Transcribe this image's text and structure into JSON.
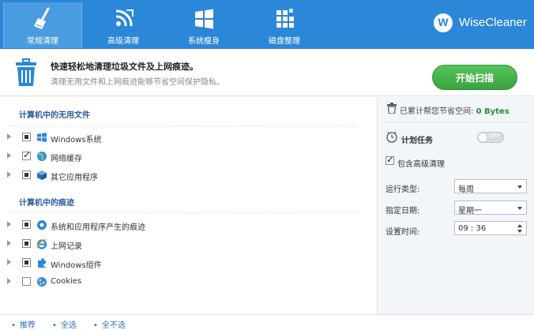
{
  "nav": {
    "tabs": [
      {
        "label": "常规清理",
        "icon": "broom-icon",
        "active": true
      },
      {
        "label": "高级清理",
        "icon": "rss-icon",
        "active": false
      },
      {
        "label": "系统瘦身",
        "icon": "windows-logo-icon",
        "active": false
      },
      {
        "label": "磁盘整理",
        "icon": "disk-defrag-icon",
        "active": false
      }
    ],
    "brand": {
      "logo_letter": "W",
      "name": "WiseCleaner"
    }
  },
  "header": {
    "title": "快速轻松地清理垃圾文件及上网痕迹。",
    "subtitle": "清理无用文件和上网痕迹能够节省空间保护隐私。",
    "scan_button": "开始扫描"
  },
  "sections": [
    {
      "title": "计算机中的无用文件",
      "items": [
        {
          "label": "Windows系统",
          "state": "mixed",
          "icon": "windows-icon"
        },
        {
          "label": "网络缓存",
          "state": "checked",
          "icon": "globe-icon"
        },
        {
          "label": "其它应用程序",
          "state": "mixed",
          "icon": "app-cube-icon"
        }
      ]
    },
    {
      "title": "计算机中的痕迹",
      "items": [
        {
          "label": "系统和应用程序产生的痕迹",
          "state": "mixed",
          "icon": "system-gear-icon"
        },
        {
          "label": "上网记录",
          "state": "mixed",
          "icon": "ie-browser-icon"
        },
        {
          "label": "Windows组件",
          "state": "mixed",
          "icon": "puzzle-icon"
        },
        {
          "label": "Cookies",
          "state": "unchecked",
          "icon": "cookie-icon"
        }
      ]
    }
  ],
  "right": {
    "saved_label": "已累计帮您节省空间: ",
    "saved_value": "0 Bytes",
    "schedule_title": "计划任务",
    "toggle_label": "OFF",
    "include_advanced": "包含高级清理",
    "fields": [
      {
        "label": "运行类型:",
        "value": "每周",
        "control": "dropdown"
      },
      {
        "label": "指定日期:",
        "value": "星期一",
        "control": "dropdown"
      },
      {
        "label": "设置时间:",
        "value": "09 : 36",
        "control": "spinner"
      }
    ]
  },
  "footer": {
    "links": [
      "推荐",
      "全选",
      "全不选"
    ]
  },
  "colors": {
    "nav_bg": "#2b87d8",
    "scan_button": "#3aa33f",
    "section_title": "#2a5fa0",
    "saved_value": "#2e8b3a"
  }
}
